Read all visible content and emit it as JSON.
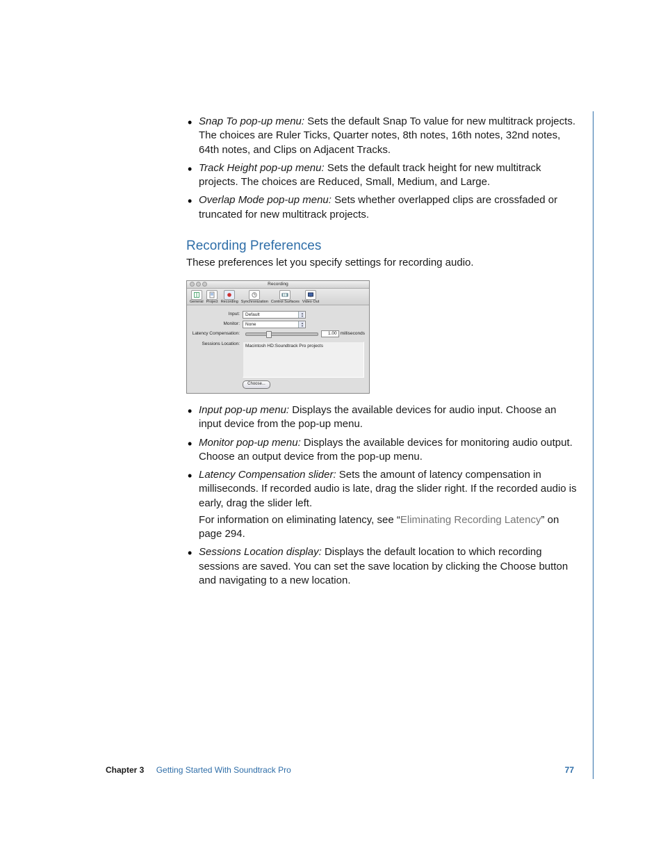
{
  "bullets_top": [
    {
      "term": "Snap To pop-up menu:",
      "text": "  Sets the default Snap To value for new multitrack projects. The choices are Ruler Ticks, Quarter notes, 8th notes, 16th notes, 32nd notes, 64th notes, and Clips on Adjacent Tracks."
    },
    {
      "term": "Track Height pop-up menu:",
      "text": "  Sets the default track height for new multitrack projects. The choices are Reduced, Small, Medium, and Large."
    },
    {
      "term": "Overlap Mode pop-up menu:",
      "text": "  Sets whether overlapped clips are crossfaded or truncated for new multitrack projects."
    }
  ],
  "section_heading": "Recording Preferences",
  "section_intro": "These preferences let you specify settings for recording audio.",
  "prefwin": {
    "title": "Recording",
    "tabs": [
      "General",
      "Project",
      "Recording",
      "Synchronization",
      "Control Surfaces",
      "Video Out"
    ],
    "input_label": "Input:",
    "input_value": "Default",
    "monitor_label": "Monitor:",
    "monitor_value": "None",
    "latency_label": "Latency Compensation:",
    "latency_value": "1.00",
    "latency_unit": "milliseconds",
    "sessions_label": "Sessions Location:",
    "sessions_path": "Macintosh HD:Soundtrack Pro projects",
    "choose_label": "Choose..."
  },
  "bullets_bottom": [
    {
      "term": "Input pop-up menu:",
      "text": "  Displays the available devices for audio input. Choose an input device from the pop-up menu."
    },
    {
      "term": "Monitor pop-up menu:",
      "text": "  Displays the available devices for monitoring audio output. Choose an output device from the pop-up menu."
    },
    {
      "term": "Latency Compensation slider:",
      "text": "  Sets the amount of latency compensation in milliseconds. If recorded audio is late, drag the slider right. If the recorded audio is early, drag the slider left.",
      "sub_pre": "For information on eliminating latency, see “",
      "sub_link": "Eliminating Recording Latency",
      "sub_post": "” on page 294."
    },
    {
      "term": "Sessions Location display:",
      "text": "  Displays the default location to which recording sessions are saved. You can set the save location by clicking the Choose button and navigating to a new location."
    }
  ],
  "footer": {
    "chapter": "Chapter 3",
    "title": "Getting Started With Soundtrack Pro",
    "page": "77"
  }
}
